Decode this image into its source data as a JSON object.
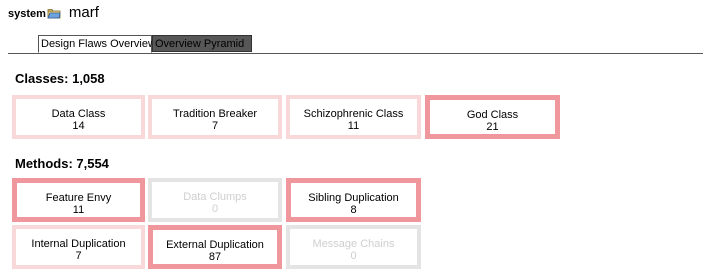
{
  "header": {
    "system_label": "system",
    "system_icon": "folder-icon",
    "project_name": "marf"
  },
  "tabs": [
    {
      "label": "Design Flaws Overview",
      "active": true
    },
    {
      "label": "Overview Pyramid",
      "active": false
    }
  ],
  "colors": {
    "strong": "#f0979e",
    "light": "#f8d8d8",
    "none": "#e4e4e4",
    "tab_inactive_bg": "#575757"
  },
  "classes": {
    "title": "Classes: 1,058",
    "cards": [
      {
        "name": "Data Class",
        "value": "14",
        "severity": "light"
      },
      {
        "name": "Tradition Breaker",
        "value": "7",
        "severity": "light"
      },
      {
        "name": "Schizophrenic Class",
        "value": "11",
        "severity": "light"
      },
      {
        "name": "God Class",
        "value": "21",
        "severity": "strong"
      }
    ]
  },
  "methods": {
    "title": "Methods: 7,554",
    "cards": [
      {
        "name": "Feature Envy",
        "value": "11",
        "severity": "strong"
      },
      {
        "name": "Data Clumps",
        "value": "0",
        "severity": "none"
      },
      {
        "name": "Sibling Duplication",
        "value": "8",
        "severity": "strong"
      },
      {
        "name": "Internal Duplication",
        "value": "7",
        "severity": "light"
      },
      {
        "name": "External Duplication",
        "value": "87",
        "severity": "strong"
      },
      {
        "name": "Message Chains",
        "value": "0",
        "severity": "none"
      }
    ]
  }
}
